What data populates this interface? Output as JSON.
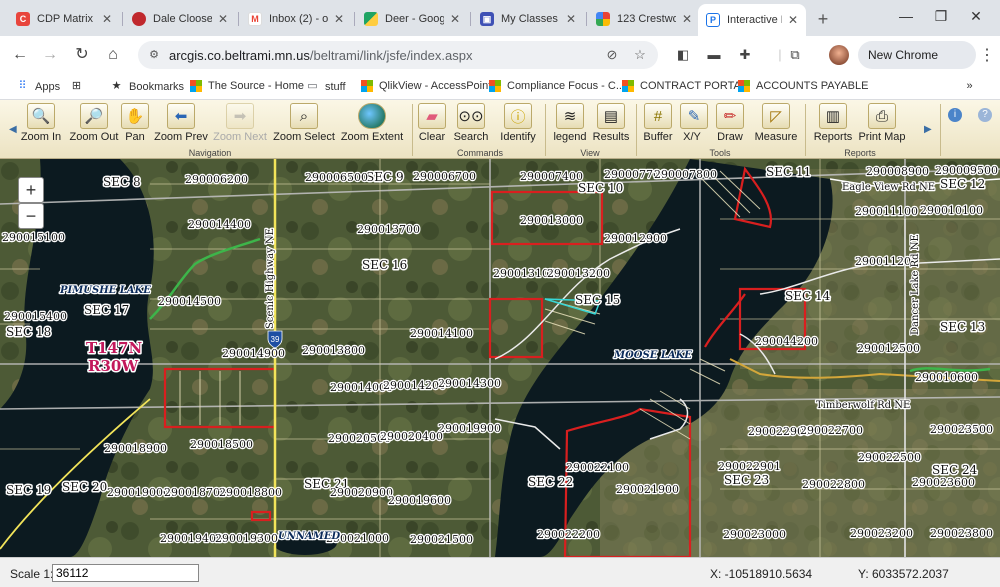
{
  "tabs": [
    {
      "label": "CDP Matrix",
      "color": "#e8453c"
    },
    {
      "label": "Dale Cloose",
      "color": "#c0282d"
    },
    {
      "label": "Inbox (2) - o",
      "color": "#ea4335"
    },
    {
      "label": "Deer - Goog",
      "color": "#1fa463"
    },
    {
      "label": "My Classes",
      "color": "#3f51b5"
    },
    {
      "label": "123 Crestwo",
      "color": "#fbbc05"
    },
    {
      "label": "Interactive M",
      "color": "#1a73e8"
    }
  ],
  "address": {
    "host": "arcgis.co.beltrami.mn.us",
    "path": "/beltrami/link/jsfe/index.aspx"
  },
  "chrome_update": "New Chrome available",
  "bookmarks": [
    "Apps",
    "Bookmarks",
    "The Source - Home",
    "stuff",
    "QlikView - AccessPoint",
    "Compliance Focus - C...",
    "CONTRACT PORTAL",
    "ACCOUNTS PAYABLE"
  ],
  "toolbar": {
    "tools": [
      "Zoom In",
      "Zoom Out",
      "Pan",
      "Zoom Prev",
      "Zoom Next",
      "Zoom Select",
      "Zoom Extent",
      "Clear",
      "Search",
      "Identify",
      "legend",
      "Results",
      "Buffer",
      "X/Y",
      "Draw",
      "Measure",
      "Reports",
      "Print Map"
    ],
    "groups": [
      "Navigation",
      "Commands",
      "View",
      "Tools",
      "Reports"
    ]
  },
  "map": {
    "sections": [
      "SEC 8",
      "SEC 9",
      "SEC 10",
      "SEC 11",
      "SEC 12",
      "SEC 16",
      "SEC 15",
      "SEC 14",
      "SEC 13",
      "SEC 17",
      "SEC 18",
      "SEC 19",
      "SEC 20",
      "SEC 21",
      "SEC 22",
      "SEC 23",
      "SEC 24"
    ],
    "places": [
      "PIMUSHE LAKE",
      "MOOSE LAKE",
      "UNNAMED"
    ],
    "township": [
      "T147N",
      "R30W"
    ],
    "roads": [
      "Scenic Highway NE",
      "Eagle View Rd NE",
      "Dancer Lake Rd NE",
      "Timberwolf Rd NE"
    ],
    "highway_shield": "39",
    "parcels": [
      "290006200",
      "290006500",
      "290006700",
      "290007400",
      "290007700",
      "290007800",
      "290008900",
      "290009500",
      "290010100",
      "290011100",
      "290013000",
      "290012900",
      "290013700",
      "290014400",
      "290015100",
      "290013100",
      "290013200",
      "290011200",
      "290014500",
      "290015400",
      "290014100",
      "290014900",
      "290013800",
      "290044200",
      "290012500",
      "290010600",
      "290014000",
      "290014200",
      "290014300",
      "290019900",
      "290018500",
      "290018900",
      "290020500",
      "290020400",
      "290022900",
      "290022700",
      "290023500",
      "290022100",
      "290022901",
      "290022500",
      "290023600",
      "290019000",
      "290018700",
      "290018800",
      "290020900",
      "290019600",
      "290021900",
      "290022800",
      "290022200",
      "290023000",
      "290023200",
      "290023800",
      "290019400",
      "290019300",
      "290021000",
      "290021500"
    ]
  },
  "status": {
    "scale_label": "Scale 1:",
    "scale_value": "36112",
    "x": "X: -10518910.5634",
    "y": "Y: 6033572.2037"
  }
}
